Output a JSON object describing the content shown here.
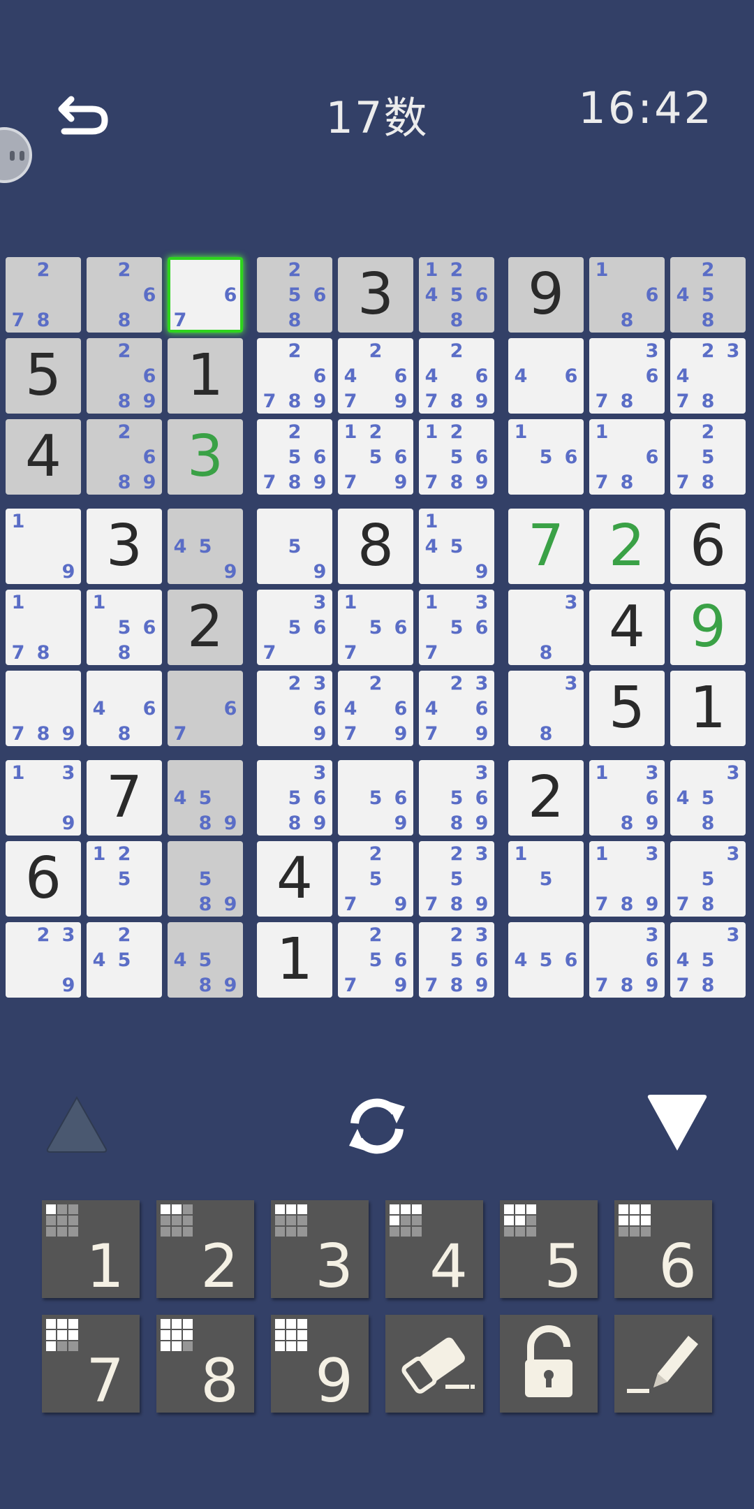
{
  "header": {
    "title": "17数",
    "clock": "16:42"
  },
  "icons": {
    "back": "undo-arrow-icon",
    "assistant": "robot-face-icon",
    "up": "triangle-up-icon",
    "down": "triangle-down-icon",
    "rotate": "rotate-arrows-icon",
    "eraser": "eraser-icon",
    "lock": "padlock-icon",
    "pencil": "pencil-icon"
  },
  "colors": {
    "background": "#334067",
    "given": "#2a2a2a",
    "entered": "#3aa146",
    "note": "#5a6dc6",
    "selected_border": "#2ed51d"
  },
  "board": {
    "selected": [
      0,
      2
    ],
    "cells": [
      [
        {
          "n": [
            2,
            7,
            8
          ],
          "bg": "g"
        },
        {
          "n": [
            2,
            6,
            8
          ],
          "bg": "g"
        },
        {
          "n": [
            6,
            7
          ],
          "bg": "w"
        },
        {
          "n": [
            2,
            5,
            6,
            8
          ],
          "bg": "g"
        },
        {
          "g": 3,
          "bg": "g"
        },
        {
          "n": [
            1,
            2,
            4,
            5,
            6,
            8
          ],
          "bg": "g"
        },
        {
          "g": 9,
          "bg": "g"
        },
        {
          "n": [
            1,
            6,
            8
          ],
          "bg": "g"
        },
        {
          "n": [
            2,
            4,
            5,
            8
          ],
          "bg": "g"
        }
      ],
      [
        {
          "g": 5,
          "bg": "g"
        },
        {
          "n": [
            2,
            6,
            8,
            9
          ],
          "bg": "g"
        },
        {
          "g": 1,
          "bg": "g"
        },
        {
          "n": [
            2,
            6,
            7,
            8,
            9
          ],
          "bg": "w"
        },
        {
          "n": [
            2,
            4,
            6,
            7,
            9
          ],
          "bg": "w"
        },
        {
          "n": [
            2,
            4,
            6,
            7,
            8,
            9
          ],
          "bg": "w"
        },
        {
          "n": [
            4,
            6
          ],
          "bg": "w"
        },
        {
          "n": [
            3,
            6,
            7,
            8
          ],
          "bg": "w"
        },
        {
          "n": [
            2,
            3,
            4,
            7,
            8
          ],
          "bg": "w"
        }
      ],
      [
        {
          "g": 4,
          "bg": "g"
        },
        {
          "n": [
            2,
            6,
            8,
            9
          ],
          "bg": "g"
        },
        {
          "v": 3,
          "bg": "g"
        },
        {
          "n": [
            2,
            5,
            6,
            7,
            8,
            9
          ],
          "bg": "w"
        },
        {
          "n": [
            1,
            2,
            5,
            6,
            7,
            9
          ],
          "bg": "w"
        },
        {
          "n": [
            1,
            2,
            5,
            6,
            7,
            8,
            9
          ],
          "bg": "w"
        },
        {
          "n": [
            1,
            5,
            6
          ],
          "bg": "w"
        },
        {
          "n": [
            1,
            6,
            7,
            8
          ],
          "bg": "w"
        },
        {
          "n": [
            2,
            5,
            7,
            8
          ],
          "bg": "w"
        }
      ],
      [
        {
          "n": [
            1,
            9
          ],
          "bg": "w"
        },
        {
          "g": 3,
          "bg": "w"
        },
        {
          "n": [
            4,
            5,
            9
          ],
          "bg": "g"
        },
        {
          "n": [
            5,
            9
          ],
          "bg": "w"
        },
        {
          "g": 8,
          "bg": "w"
        },
        {
          "n": [
            1,
            4,
            5,
            9
          ],
          "bg": "w"
        },
        {
          "v": 7,
          "bg": "w"
        },
        {
          "v": 2,
          "bg": "w"
        },
        {
          "g": 6,
          "bg": "w"
        }
      ],
      [
        {
          "n": [
            1,
            7,
            8
          ],
          "bg": "w"
        },
        {
          "n": [
            1,
            5,
            6,
            8
          ],
          "bg": "w"
        },
        {
          "g": 2,
          "bg": "g"
        },
        {
          "n": [
            3,
            5,
            6,
            7
          ],
          "bg": "w"
        },
        {
          "n": [
            1,
            5,
            6,
            7
          ],
          "bg": "w"
        },
        {
          "n": [
            1,
            3,
            5,
            6,
            7
          ],
          "bg": "w"
        },
        {
          "n": [
            3,
            8
          ],
          "bg": "w"
        },
        {
          "g": 4,
          "bg": "w"
        },
        {
          "v": 9,
          "bg": "w"
        }
      ],
      [
        {
          "n": [
            7,
            8,
            9
          ],
          "bg": "w"
        },
        {
          "n": [
            4,
            6,
            8
          ],
          "bg": "w"
        },
        {
          "n": [
            6,
            7
          ],
          "bg": "g"
        },
        {
          "n": [
            2,
            3,
            6,
            9
          ],
          "bg": "w"
        },
        {
          "n": [
            2,
            4,
            6,
            7,
            9
          ],
          "bg": "w"
        },
        {
          "n": [
            2,
            3,
            4,
            6,
            7,
            9
          ],
          "bg": "w"
        },
        {
          "n": [
            3,
            8
          ],
          "bg": "w"
        },
        {
          "g": 5,
          "bg": "w"
        },
        {
          "g": 1,
          "bg": "w"
        }
      ],
      [
        {
          "n": [
            1,
            3,
            9
          ],
          "bg": "w"
        },
        {
          "g": 7,
          "bg": "w"
        },
        {
          "n": [
            4,
            5,
            8,
            9
          ],
          "bg": "g"
        },
        {
          "n": [
            3,
            5,
            6,
            8,
            9
          ],
          "bg": "w"
        },
        {
          "n": [
            5,
            6,
            9
          ],
          "bg": "w"
        },
        {
          "n": [
            3,
            5,
            6,
            8,
            9
          ],
          "bg": "w"
        },
        {
          "g": 2,
          "bg": "w"
        },
        {
          "n": [
            1,
            3,
            6,
            8,
            9
          ],
          "bg": "w"
        },
        {
          "n": [
            3,
            4,
            5,
            8
          ],
          "bg": "w"
        }
      ],
      [
        {
          "g": 6,
          "bg": "w"
        },
        {
          "n": [
            1,
            2,
            5
          ],
          "bg": "w"
        },
        {
          "n": [
            5,
            8,
            9
          ],
          "bg": "g"
        },
        {
          "g": 4,
          "bg": "w"
        },
        {
          "n": [
            2,
            5,
            7,
            9
          ],
          "bg": "w"
        },
        {
          "n": [
            2,
            3,
            5,
            7,
            8,
            9
          ],
          "bg": "w"
        },
        {
          "n": [
            1,
            5
          ],
          "bg": "w"
        },
        {
          "n": [
            1,
            3,
            7,
            8,
            9
          ],
          "bg": "w"
        },
        {
          "n": [
            3,
            5,
            7,
            8
          ],
          "bg": "w"
        }
      ],
      [
        {
          "n": [
            2,
            3,
            9
          ],
          "bg": "w"
        },
        {
          "n": [
            2,
            4,
            5
          ],
          "bg": "w"
        },
        {
          "n": [
            4,
            5,
            8,
            9
          ],
          "bg": "g"
        },
        {
          "g": 1,
          "bg": "w"
        },
        {
          "n": [
            2,
            5,
            6,
            7,
            9
          ],
          "bg": "w"
        },
        {
          "n": [
            2,
            3,
            5,
            6,
            7,
            8,
            9
          ],
          "bg": "w"
        },
        {
          "n": [
            4,
            5,
            6
          ],
          "bg": "w"
        },
        {
          "n": [
            3,
            6,
            7,
            8,
            9
          ],
          "bg": "w"
        },
        {
          "n": [
            3,
            4,
            5,
            7,
            8
          ],
          "bg": "w"
        }
      ]
    ]
  },
  "keypad": [
    {
      "label": "1",
      "count": 1
    },
    {
      "label": "2",
      "count": 2
    },
    {
      "label": "3",
      "count": 3
    },
    {
      "label": "4",
      "count": 4
    },
    {
      "label": "5",
      "count": 5
    },
    {
      "label": "6",
      "count": 6
    },
    {
      "label": "7",
      "count": 7
    },
    {
      "label": "8",
      "count": 8
    },
    {
      "label": "9",
      "count": 9
    }
  ]
}
